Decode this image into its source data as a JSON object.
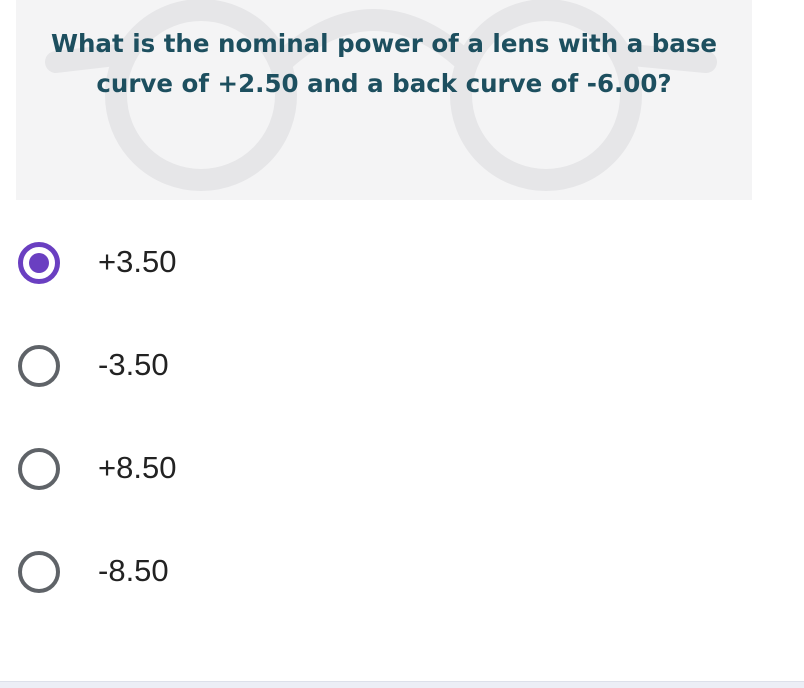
{
  "question": {
    "line1": "What is the nominal power of a lens with a base",
    "line2": "curve of +2.50 and a back curve of -6.00?",
    "background_icon": "eyeglasses-icon"
  },
  "options": [
    {
      "label": "+3.50",
      "selected": true
    },
    {
      "label": "-3.50",
      "selected": false
    },
    {
      "label": "+8.50",
      "selected": false
    },
    {
      "label": "-8.50",
      "selected": false
    }
  ],
  "colors": {
    "question_text": "#1d4f5f",
    "accent": "#6a3fc1",
    "radio_border": "#5f6368",
    "card_background": "#f4f4f5"
  }
}
